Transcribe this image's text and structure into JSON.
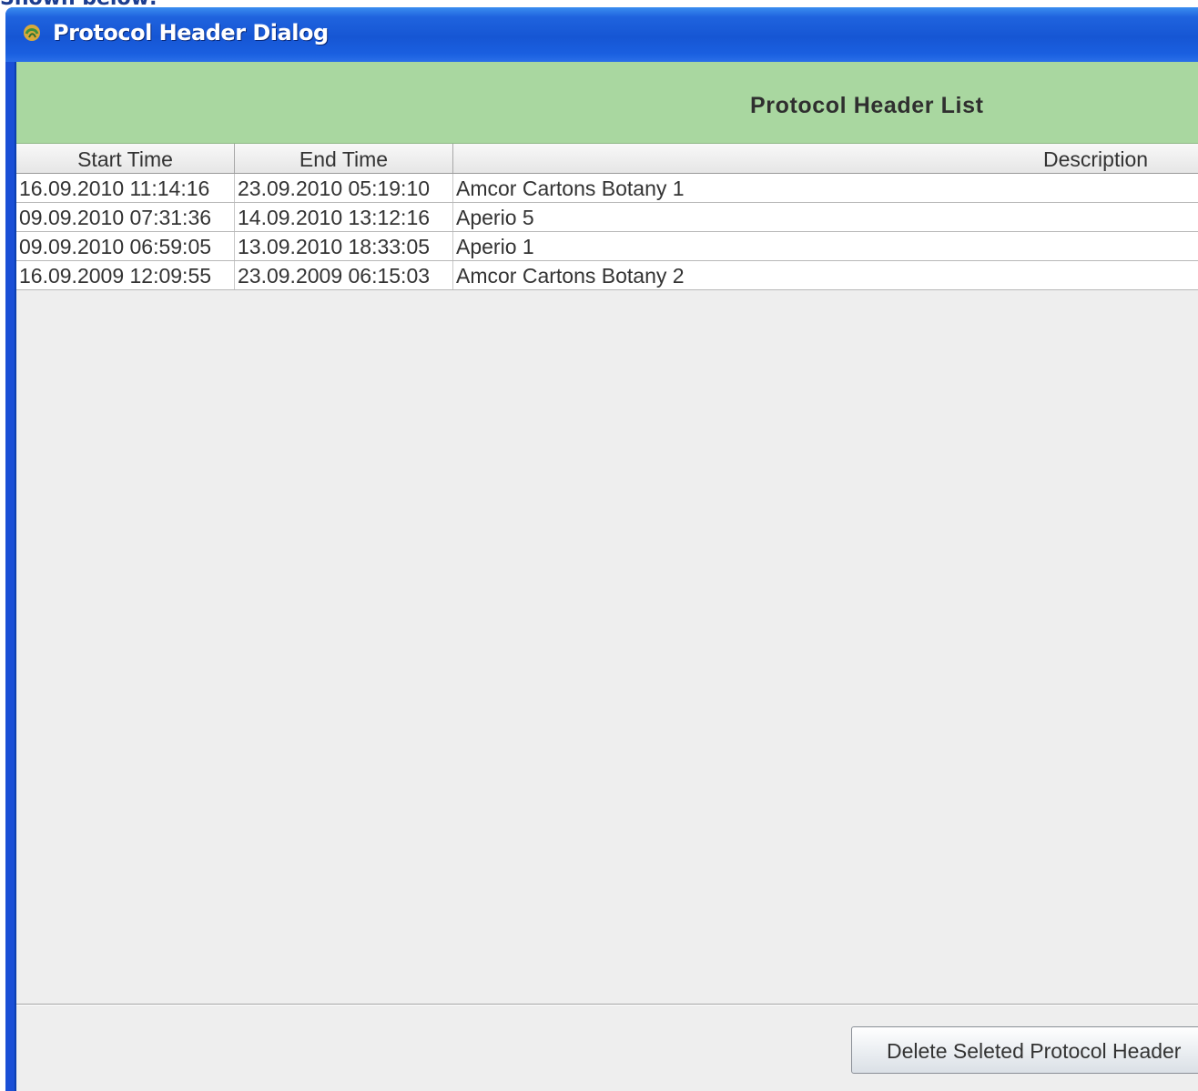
{
  "caption": "Shown below:",
  "window": {
    "title": "Protocol Header Dialog",
    "icon": "java-app-icon"
  },
  "panel": {
    "title": "Protocol Header List"
  },
  "table": {
    "columns": [
      "Start Time",
      "End Time",
      "Description"
    ],
    "rows": [
      {
        "start": "16.09.2010 11:14:16",
        "end": "23.09.2010 05:19:10",
        "description": "Amcor Cartons Botany 1"
      },
      {
        "start": "09.09.2010 07:31:36",
        "end": "14.09.2010 13:12:16",
        "description": "Aperio 5"
      },
      {
        "start": "09.09.2010 06:59:05",
        "end": "13.09.2010 18:33:05",
        "description": "Aperio 1"
      },
      {
        "start": "16.09.2009 12:09:55",
        "end": "23.09.2009 06:15:03",
        "description": "Amcor Cartons Botany 2"
      }
    ]
  },
  "footer": {
    "delete_label": "Delete Seleted Protocol Header"
  },
  "colors": {
    "titlebar": "#1656d4",
    "panel_header": "#a9d7a0",
    "background": "#eeeeee"
  }
}
